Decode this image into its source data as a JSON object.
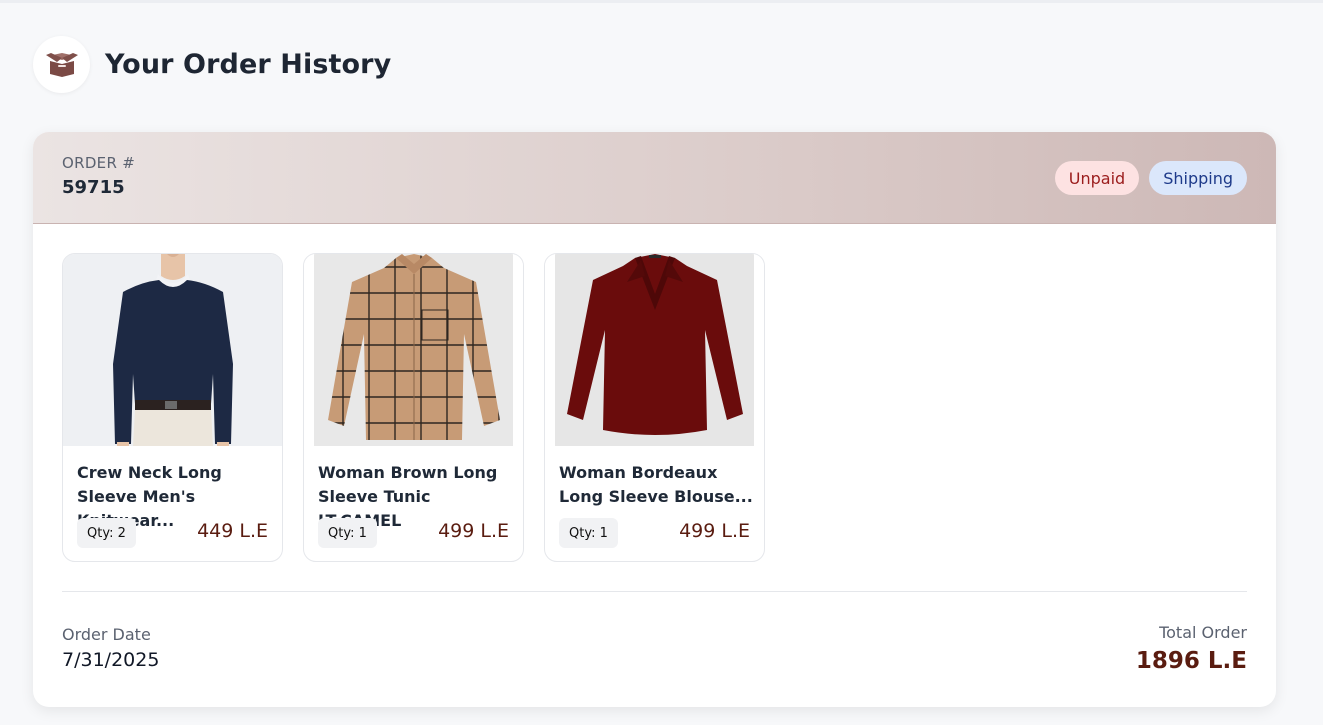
{
  "page": {
    "title": "Your Order History",
    "icon": "box-open-icon"
  },
  "order": {
    "number_label": "ORDER #",
    "number": "59715",
    "badges": {
      "payment": "Unpaid",
      "status": "Shipping"
    },
    "items": [
      {
        "name": "Crew Neck Long Sleeve Men's Knitwear...",
        "qty": "Qty: 2",
        "price": "449 L.E",
        "image": "navy-knit-sweater-photo"
      },
      {
        "name": "Woman Brown Long Sleeve Tunic LT.CAMEL",
        "qty": "Qty: 1",
        "price": "499 L.E",
        "image": "camel-plaid-shirt-photo"
      },
      {
        "name": "Woman Bordeaux Long Sleeve Blouse...",
        "qty": "Qty: 1",
        "price": "499 L.E",
        "image": "bordeaux-blouse-photo"
      }
    ],
    "date_label": "Order Date",
    "date": "7/31/2025",
    "total_label": "Total Order",
    "total": "1896 L.E"
  },
  "colors": {
    "accent": "#5a1c10",
    "unpaid_bg": "#fde2e2",
    "unpaid_text": "#9b1c1c",
    "shipping_bg": "#dbe7fb",
    "shipping_text": "#1e3a8a"
  }
}
